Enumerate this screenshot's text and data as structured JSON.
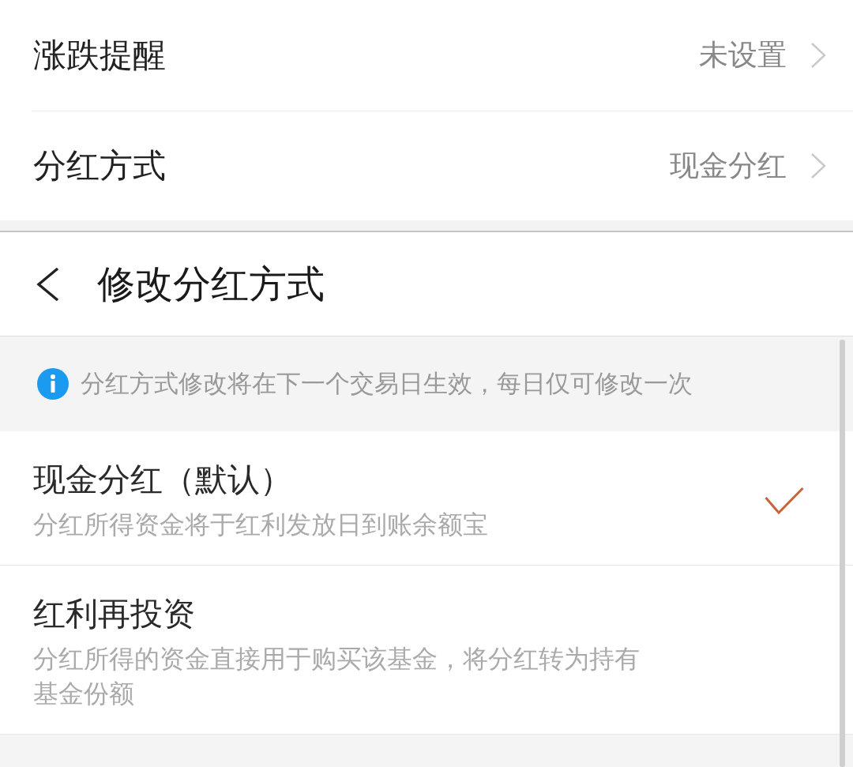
{
  "settings": [
    {
      "label": "涨跌提醒",
      "value": "未设置"
    },
    {
      "label": "分红方式",
      "value": "现金分红"
    }
  ],
  "header": {
    "title": "修改分红方式"
  },
  "notice": {
    "text": "分红方式修改将在下一个交易日生效，每日仅可修改一次"
  },
  "options": [
    {
      "title": "现金分红（默认）",
      "description": "分红所得资金将于红利发放日到账余额宝",
      "selected": true
    },
    {
      "title": "红利再投资",
      "description": "分红所得的资金直接用于购买该基金，将分红转为持有基金份额",
      "selected": false
    }
  ]
}
